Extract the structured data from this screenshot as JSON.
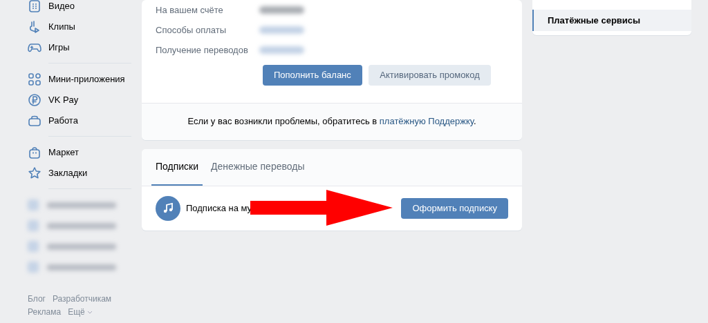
{
  "sidebar": {
    "groups": [
      [
        {
          "label": "Видео",
          "kind": "video"
        },
        {
          "label": "Клипы",
          "kind": "clips"
        },
        {
          "label": "Игры",
          "kind": "games"
        }
      ],
      [
        {
          "label": "Мини-приложения",
          "kind": "apps"
        },
        {
          "label": "VK Pay",
          "kind": "pay"
        },
        {
          "label": "Работа",
          "kind": "work"
        }
      ],
      [
        {
          "label": "Маркет",
          "kind": "market"
        },
        {
          "label": "Закладки",
          "kind": "bookmarks"
        }
      ]
    ],
    "hidden_items": [
      {
        "kind": "blurred"
      },
      {
        "kind": "blurred"
      },
      {
        "kind": "blurred"
      },
      {
        "kind": "blurred"
      }
    ],
    "footer_links": [
      {
        "label": "Блог"
      },
      {
        "label": "Разработчикам"
      },
      {
        "label": "Реклама"
      },
      {
        "label": "Ещё",
        "dropdown": true
      }
    ]
  },
  "account": {
    "rows": [
      {
        "label": "На вашем счёте",
        "kind": "amount"
      },
      {
        "label": "Способы оплаты",
        "kind": "link"
      },
      {
        "label": "Получение переводов",
        "kind": "link"
      }
    ],
    "buttons": [
      {
        "label": "Пополнить баланс",
        "kind": "primary"
      },
      {
        "label": "Активировать промокод",
        "kind": "secondary"
      }
    ],
    "help": {
      "text": "Если у вас возникли проблемы, обратитесь в ",
      "link": "платёжную Поддержку",
      "end": "."
    }
  },
  "subscriptions": {
    "tabs": [
      {
        "label": "Подписки",
        "selected": true
      },
      {
        "label": "Денежные переводы",
        "selected": false
      }
    ],
    "item": {
      "title": "Подписка на му",
      "button": "Оформить подписку"
    },
    "annotation": {
      "kind": "arrow"
    }
  },
  "right_menu": {
    "items": [
      {
        "label": "Платёжные сервисы",
        "selected": true
      }
    ]
  }
}
